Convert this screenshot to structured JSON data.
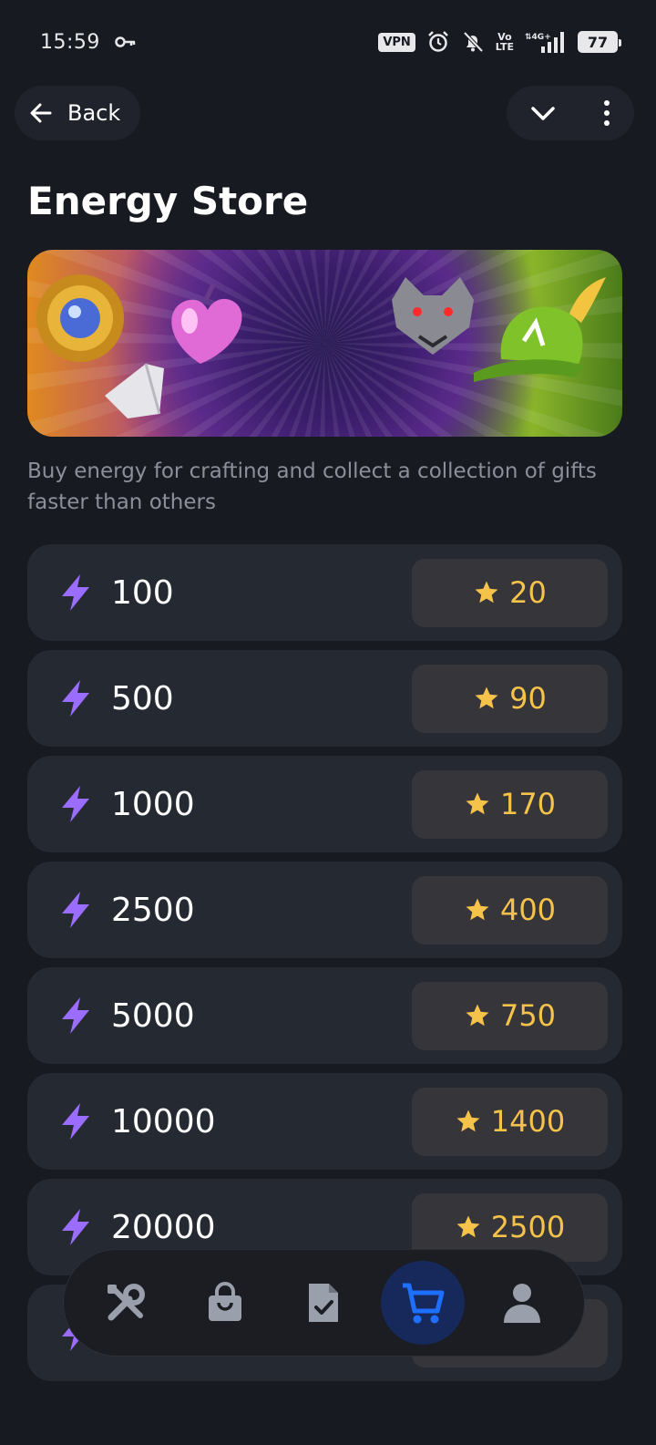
{
  "status_bar": {
    "time": "15:59",
    "vpn": "VPN",
    "volte": "Vo\nLTE",
    "network": "4G+",
    "battery": "77"
  },
  "nav": {
    "back_label": "Back"
  },
  "page": {
    "title": "Energy Store",
    "subtitle": "Buy energy for crafting and collect a collection of gifts faster than others"
  },
  "packs": [
    {
      "amount": "100",
      "price": "20"
    },
    {
      "amount": "500",
      "price": "90"
    },
    {
      "amount": "1000",
      "price": "170"
    },
    {
      "amount": "2500",
      "price": "400"
    },
    {
      "amount": "5000",
      "price": "750"
    },
    {
      "amount": "10000",
      "price": "1400"
    },
    {
      "amount": "20000",
      "price": "2500"
    },
    {
      "amount": "",
      "price": ""
    }
  ],
  "bottom_nav": {
    "items": [
      "tools-icon",
      "shopping-bag-icon",
      "document-check-icon",
      "cart-icon",
      "profile-icon"
    ],
    "active": "cart-icon"
  },
  "colors": {
    "background": "#181a21",
    "card": "#252932",
    "price_bg": "#35353a",
    "price_text": "#f5c24a",
    "energy_icon": "#9b6dff",
    "active_nav": "#1f6fff"
  }
}
